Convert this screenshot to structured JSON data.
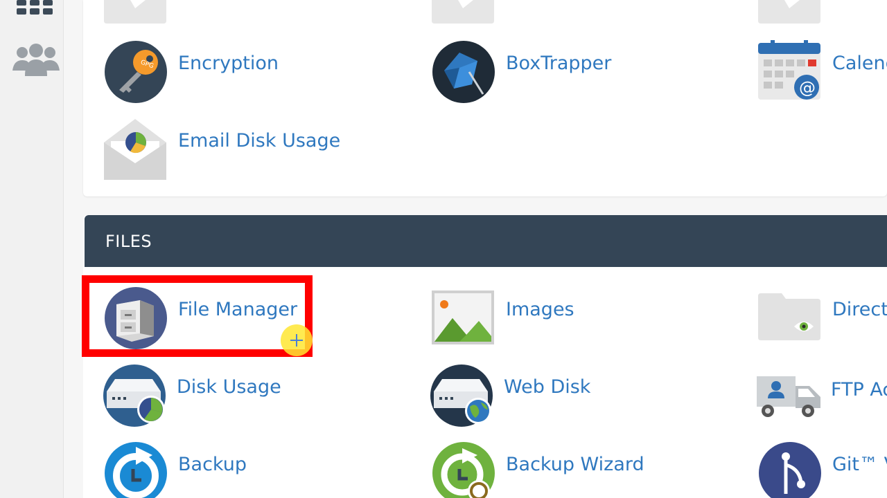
{
  "sidebar": {
    "icons": [
      "grid-icon",
      "users-icon"
    ]
  },
  "email_section": {
    "items": [
      {
        "label": "Encryption",
        "icon": "encryption-key-icon"
      },
      {
        "label": "BoxTrapper",
        "icon": "boxtrapper-icon"
      },
      {
        "label": "Calenc",
        "icon": "calendar-icon"
      },
      {
        "label": "Email Disk Usage",
        "icon": "email-disk-usage-icon"
      }
    ]
  },
  "files_section": {
    "title": "FILES",
    "items": [
      {
        "label": "File Manager",
        "icon": "file-manager-icon"
      },
      {
        "label": "Images",
        "icon": "images-icon"
      },
      {
        "label": "Directo",
        "icon": "directory-privacy-icon"
      },
      {
        "label": "Disk Usage",
        "icon": "disk-usage-icon"
      },
      {
        "label": "Web Disk",
        "icon": "web-disk-icon"
      },
      {
        "label": "FTP Ac",
        "icon": "ftp-accounts-icon"
      },
      {
        "label": "Backup",
        "icon": "backup-icon"
      },
      {
        "label": "Backup Wizard",
        "icon": "backup-wizard-icon"
      },
      {
        "label": "Git™ V",
        "icon": "git-version-control-icon"
      }
    ]
  },
  "colors": {
    "link": "#2f78bf",
    "header_bg": "#344556",
    "highlight": "#ff0000"
  }
}
